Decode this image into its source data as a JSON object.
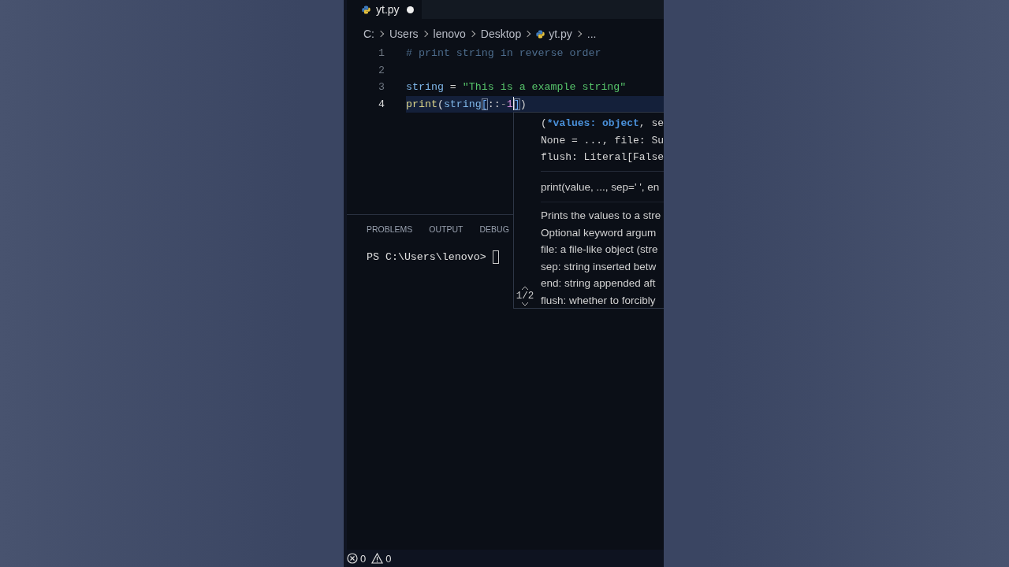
{
  "tabs": [
    {
      "label": "yt.py",
      "selected": true,
      "modified": true
    }
  ],
  "breadcrumb": [
    {
      "label": "C:",
      "kind": "folder"
    },
    {
      "label": "Users",
      "kind": "folder"
    },
    {
      "label": "lenovo",
      "kind": "folder"
    },
    {
      "label": "Desktop",
      "kind": "folder"
    },
    {
      "label": "yt.py",
      "kind": "file"
    },
    {
      "label": "...",
      "kind": "more"
    }
  ],
  "code": {
    "lines": [
      {
        "number": "1",
        "current": false,
        "tokens": [
          {
            "text": "# print string in reverse order",
            "kind": "comment"
          }
        ]
      },
      {
        "number": "2",
        "current": false
      },
      {
        "number": "3",
        "current": false,
        "tokens": [
          {
            "text": "string",
            "kind": "variable"
          },
          {
            "text": " = ",
            "kind": "plain"
          },
          {
            "text": "\"This is a example string\"",
            "kind": "string"
          }
        ]
      },
      {
        "number": "4",
        "current": true,
        "tokens": [
          {
            "text": "print",
            "kind": "function"
          },
          {
            "text": "(",
            "kind": "plain"
          },
          {
            "text": "string",
            "kind": "variable"
          },
          {
            "text": "[",
            "kind": "bracket"
          },
          {
            "text": "::",
            "kind": "plain"
          },
          {
            "text": "-",
            "kind": "operator"
          },
          {
            "text": "1",
            "kind": "number"
          },
          {
            "text": "]",
            "kind": "bracket"
          },
          {
            "text": ")",
            "kind": "plain"
          }
        ]
      }
    ]
  },
  "signature_popup": {
    "signature_lines": [
      {
        "before": "(",
        "active": "*values: object",
        "after": ", se"
      },
      {
        "before": "None = ..., file: Su"
      },
      {
        "before": "flush: Literal[False"
      }
    ],
    "label": "print(value, ..., sep=' ', en",
    "doc_lines": [
      "Prints the values to a stre",
      "Optional keyword argum",
      "file: a file-like object (stre",
      "sep: string inserted betw",
      "end: string appended aft",
      "flush: whether to forcibly"
    ],
    "counter": "1/2"
  },
  "panel": {
    "tabs": [
      {
        "label": "PROBLEMS",
        "selected": false
      },
      {
        "label": "OUTPUT",
        "selected": false
      },
      {
        "label": "DEBUG",
        "selected": false
      }
    ],
    "terminal_prompt": "PS C:\\Users\\lenovo>"
  },
  "status_bar": {
    "errors": "0",
    "warnings": "0"
  }
}
